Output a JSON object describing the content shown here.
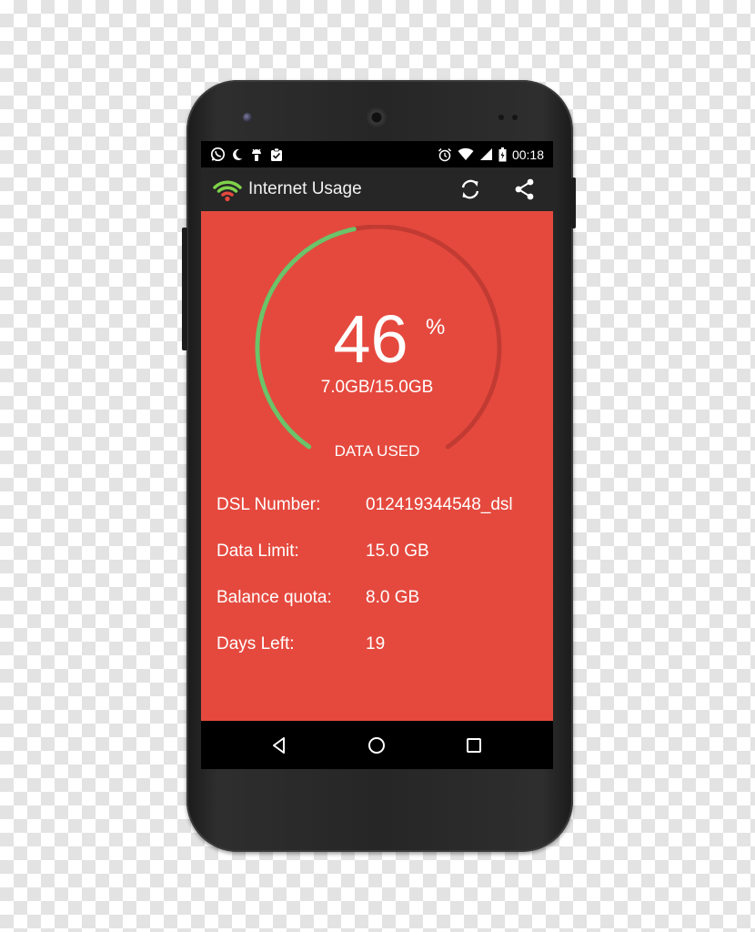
{
  "status_bar": {
    "time": "00:18",
    "left_icons": [
      "whatsapp-icon",
      "moon-icon",
      "android-icon",
      "clipboard-check-icon"
    ],
    "right_icons": [
      "alarm-icon",
      "wifi-icon",
      "signal-icon",
      "battery-icon"
    ]
  },
  "action_bar": {
    "title": "Internet Usage",
    "logo_icon": "wifi-logo-icon",
    "actions": [
      "refresh-icon",
      "share-icon"
    ]
  },
  "gauge": {
    "percent": "46",
    "percent_sign": "%",
    "used_fraction": 0.46,
    "usage_text": "7.0GB/15.0GB",
    "label": "DATA USED"
  },
  "info": [
    {
      "label": "DSL Number:",
      "value": "012419344548_dsl"
    },
    {
      "label": "Data Limit:",
      "value": "15.0 GB"
    },
    {
      "label": "Balance quota:",
      "value": "8.0 GB"
    },
    {
      "label": "Days Left:",
      "value": "19"
    }
  ],
  "nav_bar": {
    "buttons": [
      "back-icon",
      "home-icon",
      "recents-icon"
    ]
  },
  "colors": {
    "content_bg": "#e5493e",
    "gauge_used": "#6cc36a",
    "gauge_track": "#c23b33",
    "action_bar_bg": "#262626"
  }
}
